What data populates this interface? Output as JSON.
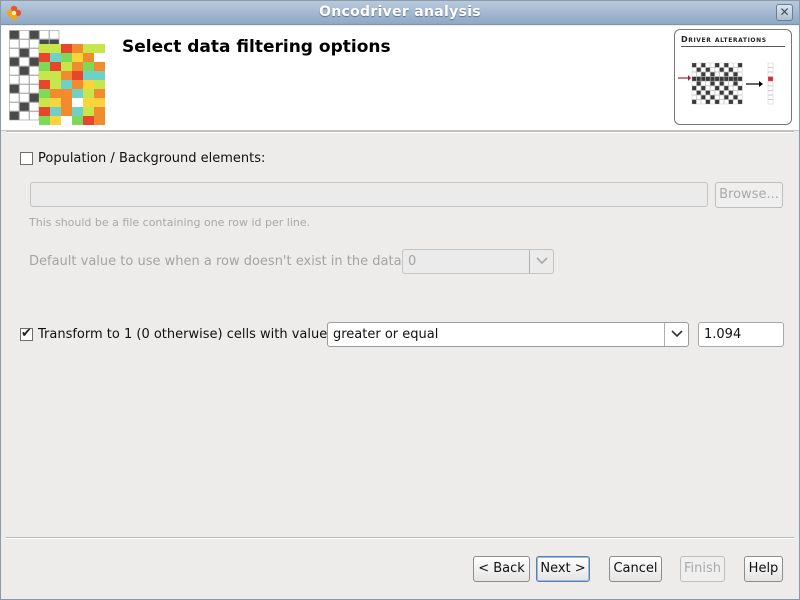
{
  "window": {
    "title": "Oncodriver analysis",
    "icon": "flower-app-icon",
    "close_icon": "close-icon"
  },
  "header": {
    "title": "Select data filtering options",
    "thumbnail_title": "Driver alterations"
  },
  "population": {
    "checkbox_label": "Population / Background elements:",
    "checked": false,
    "file_value": "",
    "browse_label": "Browse...",
    "hint": "This should be a file containing one row id per line.",
    "default_value_label": "Default value to use when a row doesn't exist in the data",
    "default_value": "0"
  },
  "transform": {
    "checkbox_label": "Transform to 1 (0 otherwise) cells with value",
    "checked": true,
    "operator": "greater or equal",
    "threshold": "1.094"
  },
  "footer": {
    "back_label": "< Back",
    "next_label": "Next >",
    "cancel_label": "Cancel",
    "finish_label": "Finish",
    "help_label": "Help"
  }
}
